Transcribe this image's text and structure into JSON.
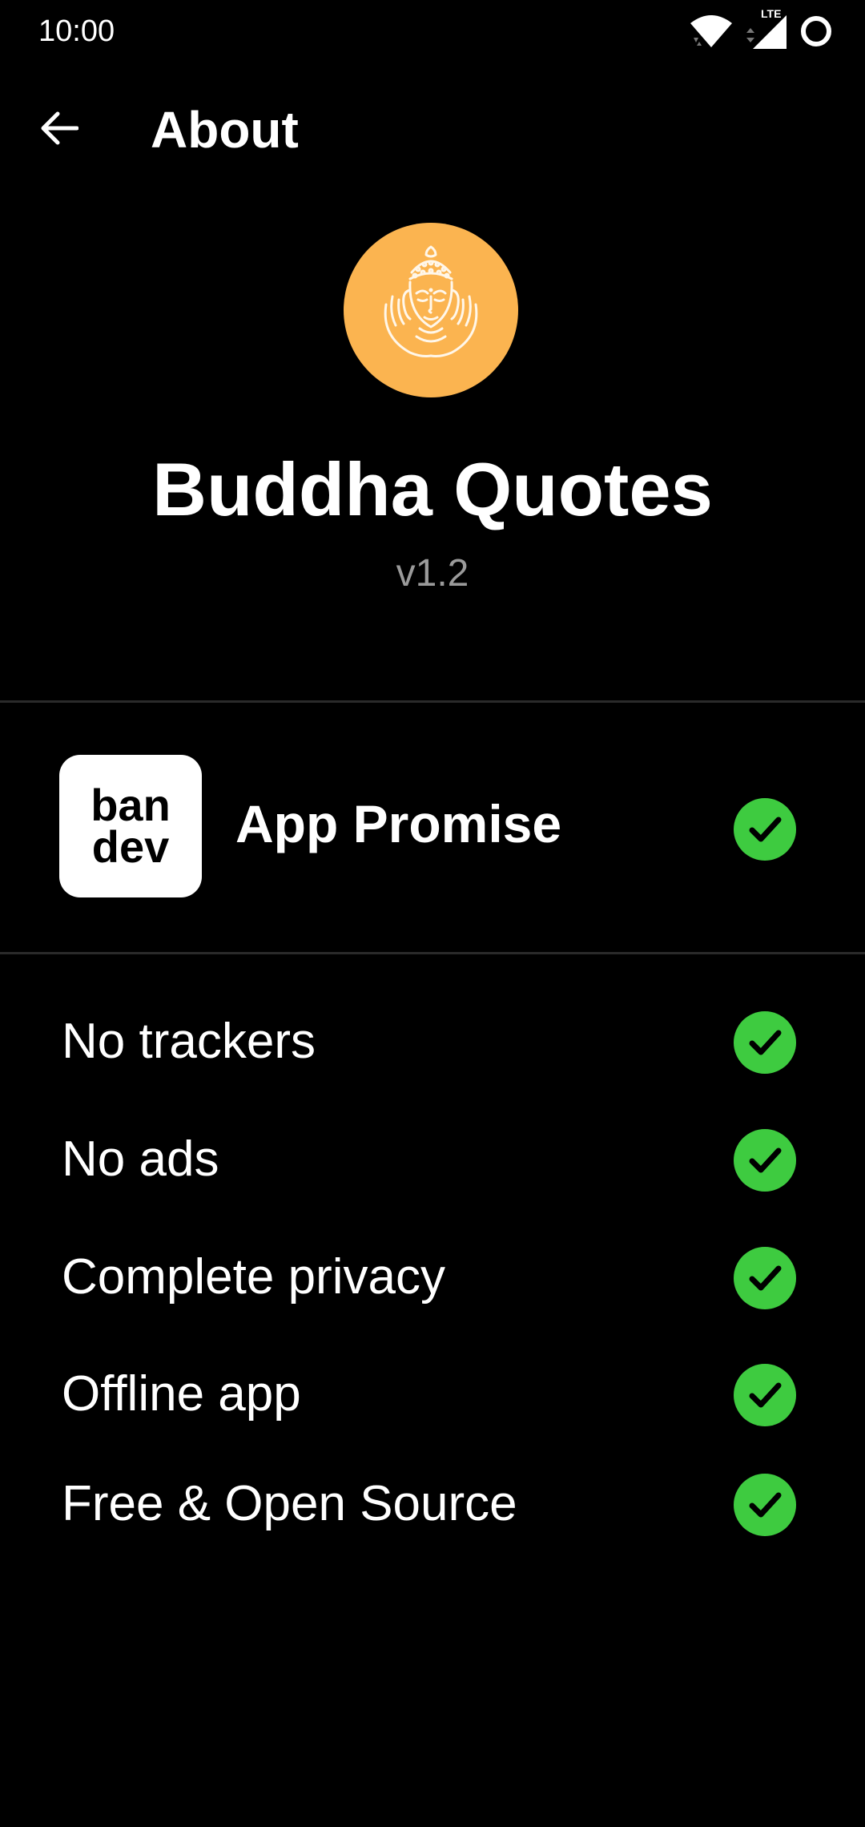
{
  "status_bar": {
    "time": "10:00",
    "network_label": "LTE",
    "icons": [
      "wifi-icon",
      "cell-signal-icon",
      "battery-icon"
    ]
  },
  "app_bar": {
    "back_icon": "arrow-back-icon",
    "title": "About"
  },
  "header": {
    "logo_icon": "buddha-face-icon",
    "app_name": "Buddha Quotes",
    "version": "v1.2"
  },
  "promise": {
    "logo_line1": "ban",
    "logo_line2": "dev",
    "title": "App Promise",
    "status_icon": "check-circle-icon"
  },
  "features": [
    {
      "label": "No trackers",
      "icon": "check-circle-icon"
    },
    {
      "label": "No ads",
      "icon": "check-circle-icon"
    },
    {
      "label": "Complete privacy",
      "icon": "check-circle-icon"
    },
    {
      "label": "Offline app",
      "icon": "check-circle-icon"
    },
    {
      "label": "Free & Open Source",
      "icon": "check-circle-icon"
    }
  ],
  "colors": {
    "background": "#000000",
    "logo_orange": "#fbb450",
    "check_green": "#3ecb40",
    "version_gray": "#9a9a9a",
    "divider": "#2a2a2a"
  }
}
